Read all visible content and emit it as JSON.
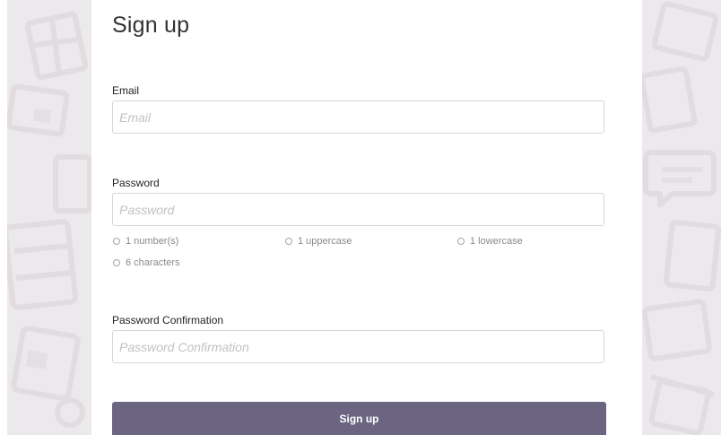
{
  "form": {
    "title": "Sign up",
    "email": {
      "label": "Email",
      "placeholder": "Email",
      "value": ""
    },
    "password": {
      "label": "Password",
      "placeholder": "Password",
      "value": "",
      "rules": [
        {
          "text": "1 number(s)",
          "met": false
        },
        {
          "text": "1 uppercase",
          "met": false
        },
        {
          "text": "1 lowercase",
          "met": false
        },
        {
          "text": "6 characters",
          "met": false
        }
      ]
    },
    "password_confirmation": {
      "label": "Password Confirmation",
      "placeholder": "Password Confirmation",
      "value": ""
    },
    "submit_label": "Sign up"
  },
  "colors": {
    "accent": "#6c6581",
    "background_pattern": "#ece9ec",
    "rule_icon": "#a5a5a5"
  },
  "icons": {
    "rule_indicator": "radio-circle-icon",
    "background": "background-pattern-icons"
  }
}
